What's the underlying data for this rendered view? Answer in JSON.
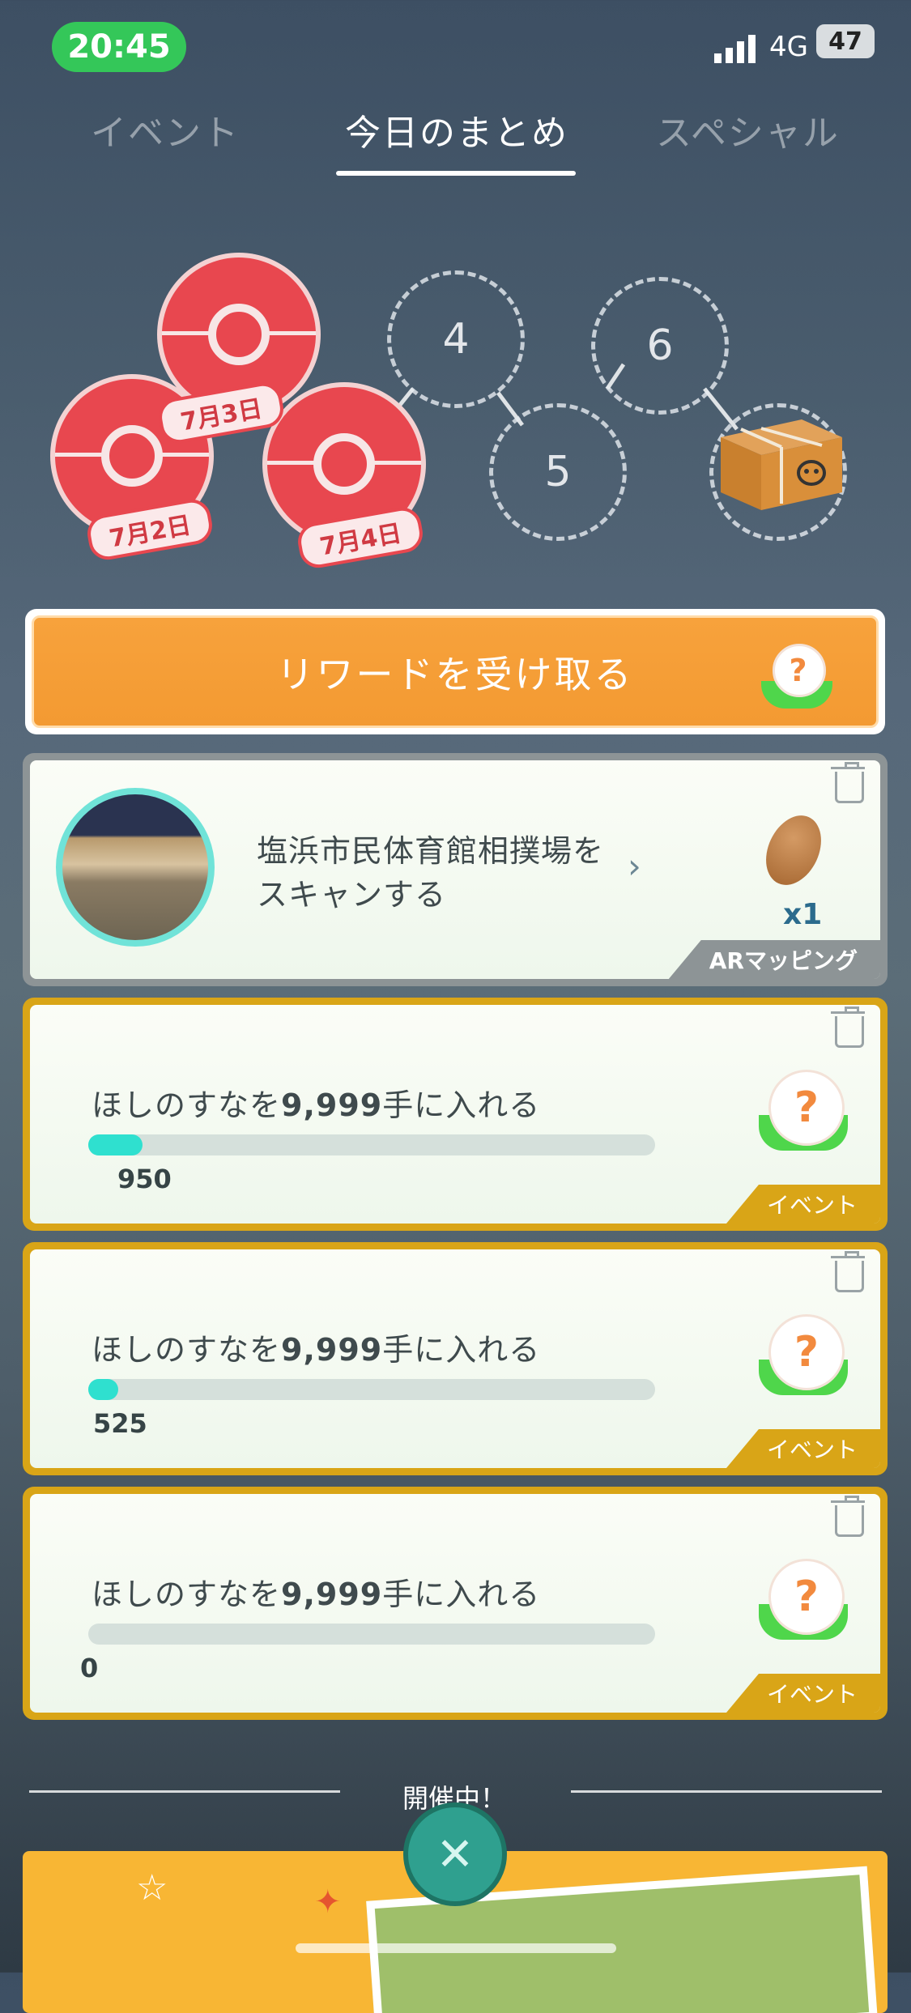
{
  "status": {
    "time": "20:45",
    "network": "4G",
    "battery": "47"
  },
  "tabs": [
    {
      "label": "イベント",
      "active": false
    },
    {
      "label": "今日のまとめ",
      "active": true
    },
    {
      "label": "スペシャル",
      "active": false
    }
  ],
  "stamps": [
    {
      "label": "7月3日"
    },
    {
      "label": "7月2日"
    },
    {
      "label": "7月4日"
    }
  ],
  "slots": [
    "4",
    "5",
    "6"
  ],
  "reward": {
    "label": "リワードを受け取る"
  },
  "ar_task": {
    "text": "塩浜市民体育館相撲場をスキャンする",
    "reward_count": "x1",
    "tag": "ARマッピング"
  },
  "tasks": [
    {
      "text_pre": "ほしのすなを",
      "text_num": "9,999",
      "text_post": "手に入れる",
      "progress": 950,
      "target": 9999,
      "count": "950",
      "tag": "イベント"
    },
    {
      "text_pre": "ほしのすなを",
      "text_num": "9,999",
      "text_post": "手に入れる",
      "progress": 525,
      "target": 9999,
      "count": "525",
      "tag": "イベント"
    },
    {
      "text_pre": "ほしのすなを",
      "text_num": "9,999",
      "text_post": "手に入れる",
      "progress": 0,
      "target": 9999,
      "count": "0",
      "tag": "イベント"
    }
  ],
  "bottom": {
    "live_label": "開催中！",
    "close_icon": "✕"
  },
  "colors": {
    "accent_orange": "#f39a32",
    "event_gold": "#d9a517",
    "progress_teal": "#2fe0cf",
    "stamp_red": "#e8474f"
  }
}
